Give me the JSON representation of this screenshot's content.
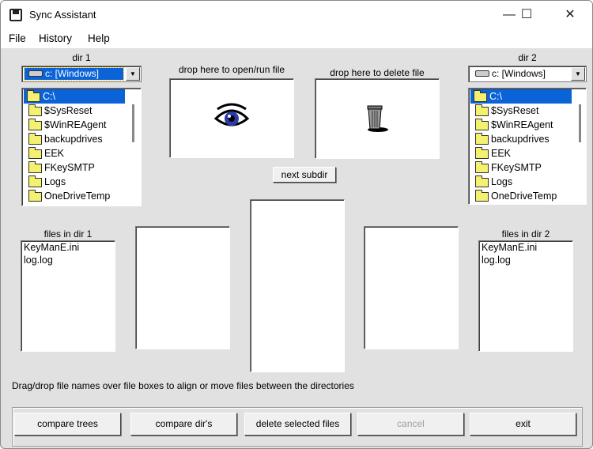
{
  "window": {
    "title": "Sync Assistant",
    "controls": {
      "minimize": "—",
      "maximize": "☐",
      "close": "✕"
    }
  },
  "menu": [
    "File",
    "History",
    "Help"
  ],
  "dir1": {
    "label": "dir 1",
    "drive": "c: [Windows]",
    "tree": [
      "C:\\",
      "$SysReset",
      "$WinREAgent",
      "backupdrives",
      "EEK",
      "FKeySMTP",
      "Logs",
      "OneDriveTemp"
    ]
  },
  "dir2": {
    "label": "dir 2",
    "drive": "c: [Windows]",
    "tree": [
      "C:\\",
      "$SysReset",
      "$WinREAgent",
      "backupdrives",
      "EEK",
      "FKeySMTP",
      "Logs",
      "OneDriveTemp"
    ]
  },
  "drop_open": {
    "label": "drop here to open/run file",
    "icon": "eye-icon"
  },
  "drop_delete": {
    "label": "drop here to delete file",
    "icon": "trash-icon"
  },
  "next_subdir": "next subdir",
  "files1": {
    "label": "files in dir 1",
    "items": [
      "KeyManE.ini",
      "log.log"
    ]
  },
  "files2": {
    "label": "files in dir 2",
    "items": [
      "KeyManE.ini",
      "log.log"
    ]
  },
  "status": "Drag/drop file names over file boxes to align or move files between the directories",
  "buttons": {
    "compare_trees": "compare trees",
    "compare_dirs": "compare dir's",
    "delete_selected": "delete selected files",
    "cancel": "cancel",
    "exit": "exit"
  }
}
